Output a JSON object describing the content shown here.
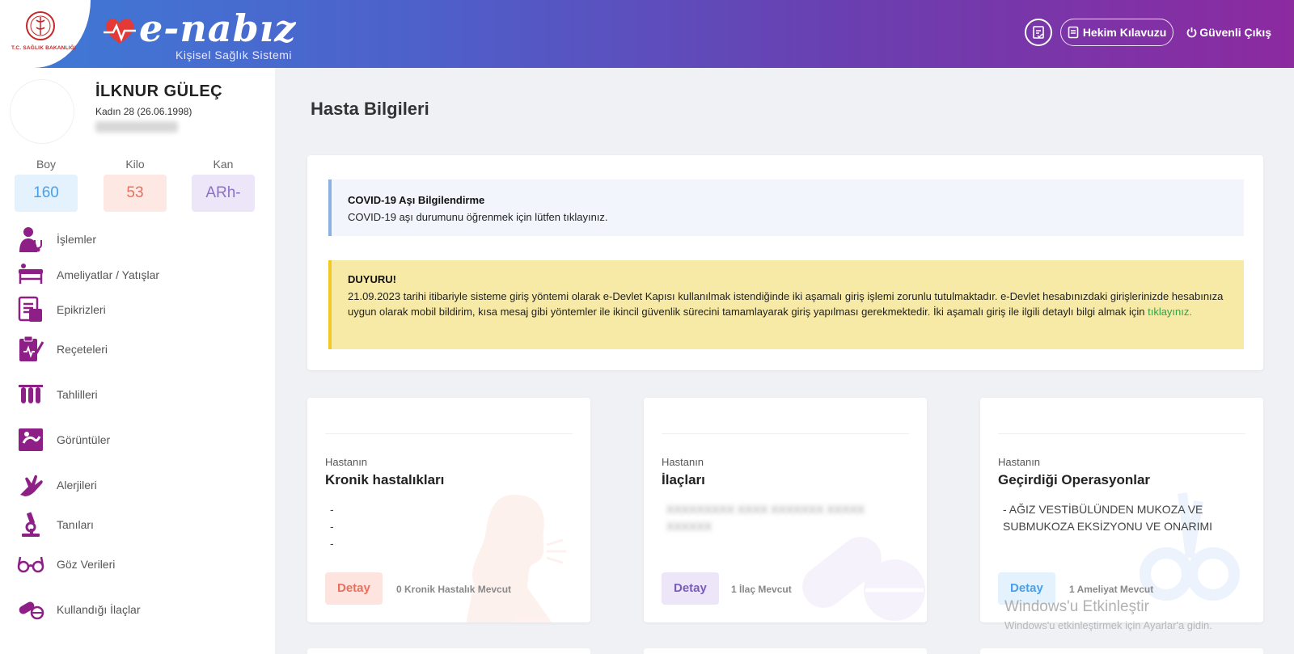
{
  "header": {
    "ministry": "T.C. SAĞLIK BAKANLIĞI",
    "brand_name": "e-nabız",
    "brand_sub": "Kişisel Sağlık Sistemi",
    "guide_label": "Hekim Kılavuzu",
    "logout_label": "Güvenli Çıkış"
  },
  "patient": {
    "name": "İLKNUR GÜLEÇ",
    "info": "Kadın 28 (26.06.1998)",
    "stats": {
      "boy_label": "Boy",
      "boy_value": "160",
      "kilo_label": "Kilo",
      "kilo_value": "53",
      "kan_label": "Kan",
      "kan_value": "ARh-"
    }
  },
  "menu": [
    {
      "label": "İşlemler",
      "icon": "doctor-icon"
    },
    {
      "label": "Ameliyatlar / Yatışlar",
      "icon": "bed-icon"
    },
    {
      "label": "Epikrizleri",
      "icon": "document-icon"
    },
    {
      "label": "Reçeteleri",
      "icon": "prescription-icon"
    },
    {
      "label": "Tahlilleri",
      "icon": "test-tubes-icon"
    },
    {
      "label": "Görüntüler",
      "icon": "xray-icon"
    },
    {
      "label": "Alerjileri",
      "icon": "allergy-hand-icon"
    },
    {
      "label": "Tanıları",
      "icon": "microscope-icon"
    },
    {
      "label": "Göz Verileri",
      "icon": "glasses-icon"
    },
    {
      "label": "Kullandığı İlaçlar",
      "icon": "pill-icon"
    }
  ],
  "main": {
    "title": "Hasta Bilgileri",
    "covid": {
      "title": "COVID-19 Aşı Bilgilendirme",
      "text": "COVID-19 aşı durumunu öğrenmek için lütfen tıklayınız."
    },
    "announcement": {
      "title": "DUYURU!",
      "text": "21.09.2023 tarihi itibariyle sisteme giriş yöntemi olarak e-Devlet Kapısı kullanılmak istendiğinde iki aşamalı giriş işlemi zorunlu tutulmaktadır. e-Devlet hesabınızdaki girişlerinizde hesabınıza uygun olarak mobil bildirim, kısa mesaj gibi yöntemler ile ikincil güvenlik sürecini tamamlayarak giriş yapılması gerekmektedir. İki aşamalı giriş ile ilgili detaylı bilgi almak için ",
      "link": "tıklayınız."
    },
    "cards": [
      {
        "sub": "Hastanın",
        "title": "Kronik hastalıkları",
        "lines": [
          "-",
          "-",
          "-"
        ],
        "button": "Detay",
        "count": "0 Kronik Hastalık Mevcut"
      },
      {
        "sub": "Hastanın",
        "title": "İlaçları",
        "blurred_lines": [
          "XXXXXXXXX XXXX XXXXXXX XXXXX",
          "XXXXXX"
        ],
        "button": "Detay",
        "count": "1 İlaç Mevcut"
      },
      {
        "sub": "Hastanın",
        "title": "Geçirdiği Operasyonlar",
        "lines": [
          "- AĞIZ VESTİBÜLÜNDEN MUKOZA VE",
          "SUBMUKOZA EKSİZYONU VE ONARIMI"
        ],
        "button": "Detay",
        "count": "1 Ameliyat Mevcut"
      }
    ]
  },
  "watermark": {
    "title": "Windows'u Etkinleştir",
    "sub": "Windows'u etkinleştirmek için Ayarlar'a gidin."
  },
  "colors": {
    "header_start": "#3e7bd6",
    "header_end": "#8c2aa0",
    "menu_icon": "#8e1f86",
    "warn_bg": "#f7e9a6",
    "link": "#28a745"
  }
}
